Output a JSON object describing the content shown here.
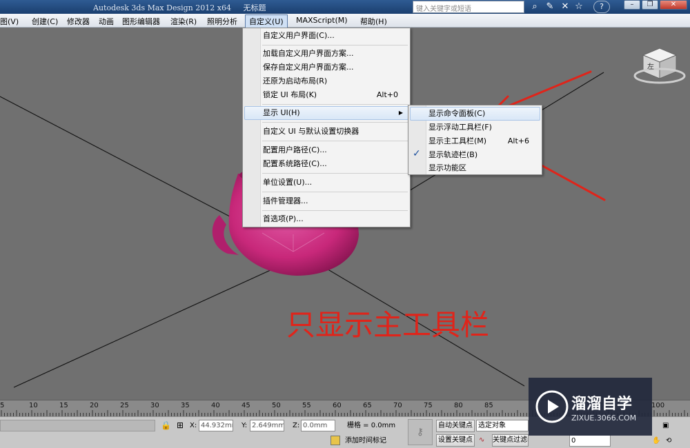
{
  "window": {
    "title": "Autodesk 3ds Max Design 2012 x64",
    "document": "无标题",
    "search_placeholder": "键入关键字或短语",
    "help_icon_label": "?"
  },
  "menubar": {
    "items": [
      "图(V)",
      "创建(C)",
      "修改器",
      "动画",
      "图形编辑器",
      "渲染(R)",
      "照明分析",
      "自定义(U)",
      "MAXScript(M)",
      "帮助(H)"
    ],
    "active_index": 7
  },
  "customize_menu": {
    "items": [
      {
        "label": "自定义用户界面(C)..."
      },
      {
        "label": "加载自定义用户界面方案..."
      },
      {
        "label": "保存自定义用户界面方案..."
      },
      {
        "label": "还原为启动布局(R)"
      },
      {
        "label": "锁定 UI 布局(K)",
        "shortcut": "Alt+0"
      },
      {
        "label": "显示 UI(H)",
        "submenu": true,
        "highlighted": true
      },
      {
        "label": "自定义 UI 与默认设置切换器"
      },
      {
        "label": "配置用户路径(C)..."
      },
      {
        "label": "配置系统路径(C)..."
      },
      {
        "label": "单位设置(U)..."
      },
      {
        "label": "插件管理器..."
      },
      {
        "label": "首选项(P)..."
      }
    ]
  },
  "show_ui_submenu": {
    "items": [
      {
        "label": "显示命令面板(C)",
        "highlighted": true
      },
      {
        "label": "显示浮动工具栏(F)"
      },
      {
        "label": "显示主工具栏(M)",
        "shortcut": "Alt+6"
      },
      {
        "label": "显示轨迹栏(B)",
        "checked": true
      },
      {
        "label": "显示功能区"
      }
    ]
  },
  "annotation": {
    "text": "只显示主工具栏",
    "color": "#e0241a"
  },
  "timeline": {
    "ticks": [
      "5",
      "10",
      "15",
      "20",
      "25",
      "30",
      "35",
      "40",
      "45",
      "50",
      "55",
      "60",
      "65",
      "70",
      "75",
      "80",
      "85",
      "100"
    ]
  },
  "status": {
    "x_label": "X:",
    "x_value": "44.932mm",
    "y_label": "Y:",
    "y_value": "2.649mm",
    "z_label": "Z:",
    "z_value": "0.0mm",
    "grid": "栅格 = 0.0mm",
    "auto_key": "自动关键点",
    "set_key": "设置关键点",
    "selection": "选定对象",
    "key_filters": "关键点过滤器...",
    "add_time_tag": "添加时间标记",
    "frame": "0"
  },
  "watermark": {
    "main": "溜溜自学",
    "sub": "ZIXUE.3066.COM"
  },
  "viewcube": {
    "face_label": "左"
  },
  "colors": {
    "teapot": "#c8287a",
    "arrow": "#e0241a",
    "title_bar": "#1b3f6f",
    "menu_highlight": "#d9e7f7"
  }
}
